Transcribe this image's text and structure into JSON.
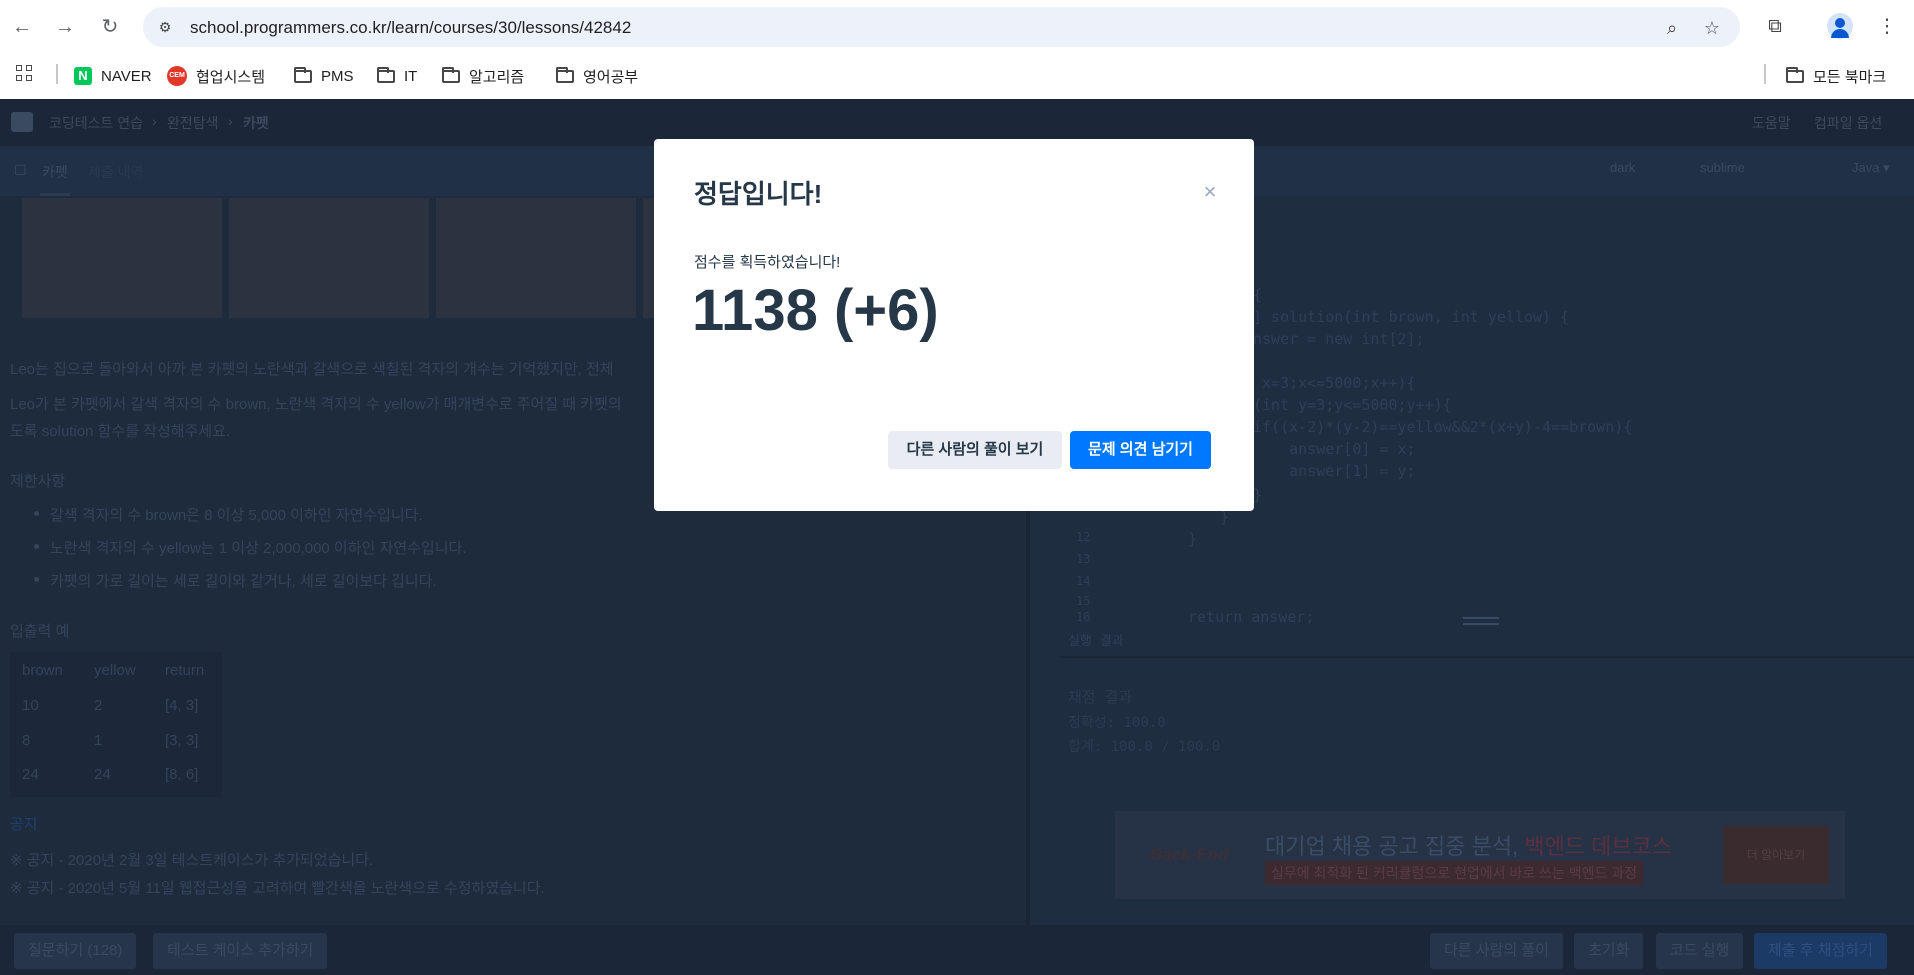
{
  "browser": {
    "url": "school.programmers.co.kr/learn/courses/30/lessons/42842",
    "bookmarks": [
      {
        "label": "NAVER",
        "icon": "naver-icon"
      },
      {
        "label": "협업시스템",
        "icon": "collab-icon"
      },
      {
        "label": "PMS",
        "icon": "folder-icon"
      },
      {
        "label": "IT",
        "icon": "folder-icon"
      },
      {
        "label": "알고리즘",
        "icon": "folder-icon"
      },
      {
        "label": "영어공부",
        "icon": "folder-icon"
      }
    ],
    "all_bookmarks": "모든 북마크"
  },
  "page": {
    "breadcrumb": [
      "코딩테스트 연습",
      "완전탐색",
      "카펫"
    ],
    "header_links": [
      "도움말",
      "컴파일 옵션"
    ],
    "tabs": [
      "카펫",
      "제출 내역"
    ],
    "editor_options": [
      "dark",
      "sublime",
      "Java ▾"
    ],
    "description_1": "Leo는 집으로 돌아와서 아까 본 카펫의 노란색과 갈색으로 색칠된 격자의 개수는 기억했지만, 전체",
    "description_2": "Leo가 본 카펫에서 갈색 격자의 수 brown, 노란색 격자의 수 yellow가 매개변수로 주어질 때 카펫의",
    "description_3": "도록 solution 함수를 작성해주세요.",
    "constraints_title": "제한사항",
    "constraints": [
      "갈색 격자의 수 brown은 8 이상 5,000 이하인 자연수입니다.",
      "노란색 격자의 수 yellow는 1 이상 2,000,000 이하인 자연수입니다.",
      "카펫의 가로 길이는 세로 길이와 같거나, 세로 길이보다 깁니다."
    ],
    "io_title": "입출력 예",
    "io_table": {
      "headers": [
        "brown",
        "yellow",
        "return"
      ],
      "rows": [
        [
          "10",
          "2",
          "[4, 3]"
        ],
        [
          "8",
          "1",
          "[3, 3]"
        ],
        [
          "24",
          "24",
          "[8, 6]"
        ]
      ]
    },
    "notice_label": "공지",
    "notices": [
      "※ 공지 - 2020년 2월 3일 테스트케이스가 추가되었습니다.",
      "※ 공지 - 2020년 5월 11일 웹접근성을 고려하여 빨간색을 노란색으로 수정하였습니다."
    ],
    "code_lines": [
      "{",
      "] solution(int brown, int yellow) {",
      "nswer = new int[2];",
      "",
      " x=3;x<=5000;x++){",
      "(int y=3;y<=5000;y++){",
      "if((x-2)*(y-2)==yellow&&2*(x+y)-4==brown){",
      "    answer[0] = x;",
      "    answer[1] = y;",
      "}"
    ],
    "code_tail": [
      "}",
      "}",
      "return answer;"
    ],
    "line_numbers": [
      "12",
      "13",
      "14",
      "15",
      "16"
    ],
    "run_result_label": "실행 결과",
    "result_title": "채점 결과",
    "result_accuracy": "정확성: 100.0",
    "result_total": "합계: 100.0 / 100.0",
    "ad_title_prefix": "대기업 채용 공고 집중 분석, ",
    "ad_title_highlight": "백엔드 데브코스",
    "ad_sub": "실무에 최적화 된 커리큘럼으로 현업에서 바로 쓰는 백엔드 과정",
    "ad_logo": "Back-End",
    "ad_button": "더 알아보기",
    "footer_left": [
      "질문하기 (128)",
      "테스트 케이스 추가하기"
    ],
    "footer_right": [
      "다른 사람의 풀이",
      "초기화",
      "코드 실행",
      "제출 후 채점하기"
    ]
  },
  "modal": {
    "title": "정답입니다!",
    "close": "×",
    "subtitle": "점수를 획득하였습니다!",
    "score": "1138 (+6)",
    "btn_secondary": "다른 사람의 풀이 보기",
    "btn_primary": "문제 의견 남기기"
  }
}
